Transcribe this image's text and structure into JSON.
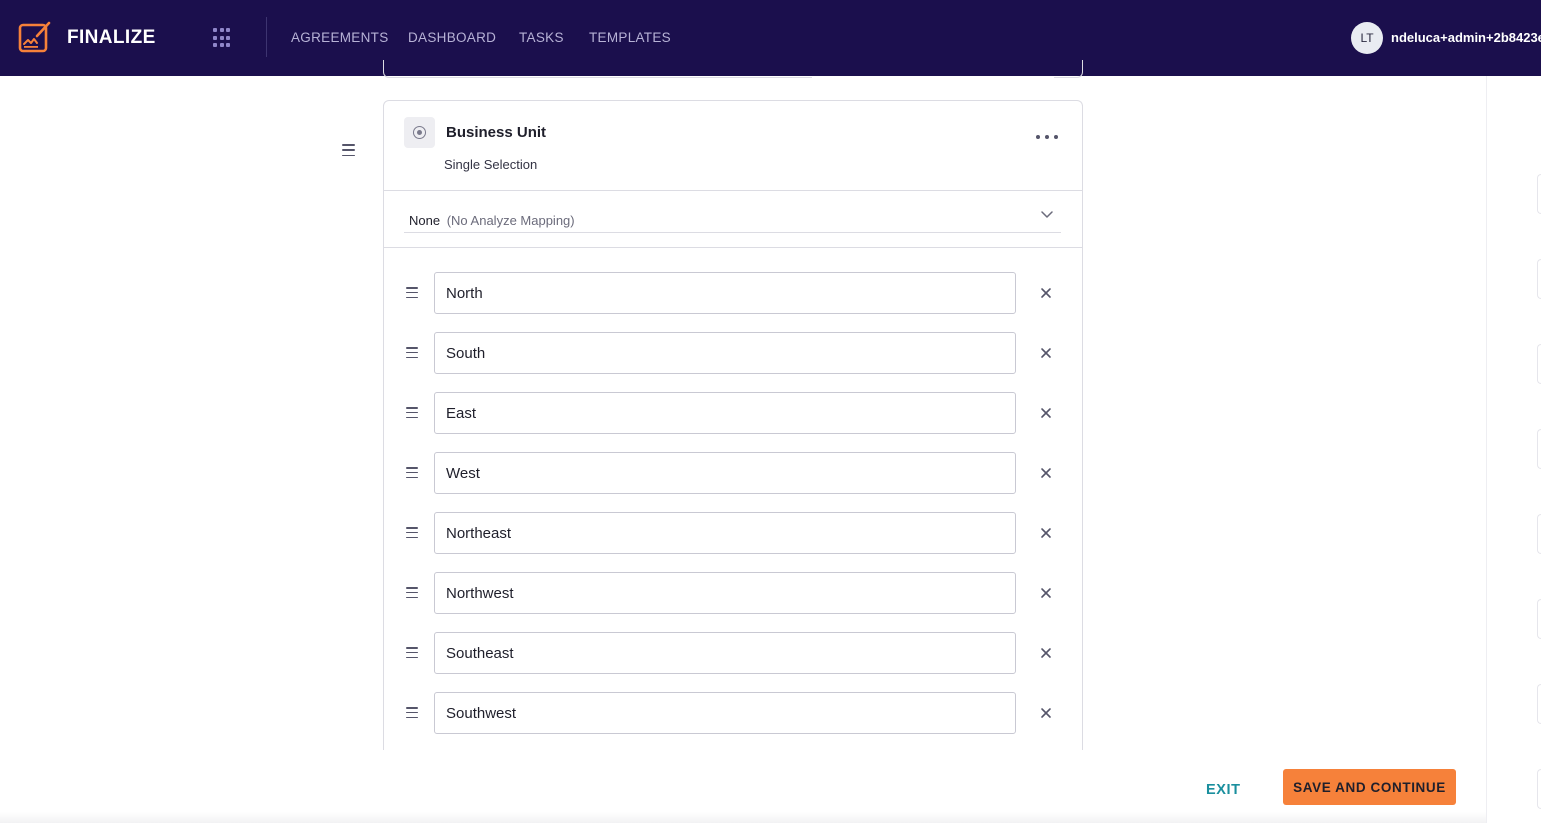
{
  "app": {
    "brand": "FINALIZE",
    "nav": [
      {
        "label": "AGREEMENTS"
      },
      {
        "label": "DASHBOARD"
      },
      {
        "label": "TASKS"
      },
      {
        "label": "TEMPLATES"
      }
    ],
    "user": {
      "initials": "LT",
      "email": "ndeluca+admin+2b8423e"
    }
  },
  "field": {
    "title": "Business Unit",
    "type_label": "Single Selection",
    "mapping": {
      "value": "None",
      "hint": "(No Analyze Mapping)"
    },
    "options": [
      {
        "value": "North"
      },
      {
        "value": "South"
      },
      {
        "value": "East"
      },
      {
        "value": "West"
      },
      {
        "value": "Northeast"
      },
      {
        "value": "Northwest"
      },
      {
        "value": "Southeast"
      },
      {
        "value": "Southwest"
      }
    ]
  },
  "footer": {
    "exit_label": "EXIT",
    "save_label": "SAVE AND CONTINUE"
  },
  "colors": {
    "nav_background": "#1b0f4d",
    "brand_accent": "#f6813a",
    "exit_link": "#1a8f9e"
  },
  "icons": [
    "finalize-logo",
    "apps-grid-icon",
    "radio-icon",
    "more-icon",
    "chevron-down-icon",
    "drag-handle-icon",
    "close-icon"
  ]
}
